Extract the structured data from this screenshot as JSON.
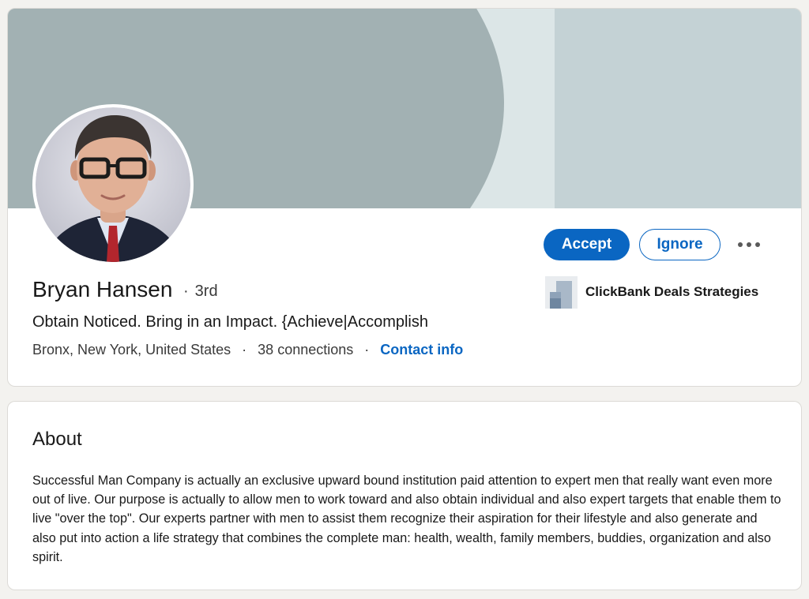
{
  "profile": {
    "name": "Bryan Hansen",
    "degree": "3rd",
    "headline": "Obtain Noticed. Bring in an Impact. {Achieve|Accomplish",
    "location": "Bronx, New York, United States",
    "connections": "38 connections",
    "contact_info": "Contact info",
    "separator": "·"
  },
  "actions": {
    "accept_label": "Accept",
    "ignore_label": "Ignore",
    "more_icon": "more-horizontal-icon"
  },
  "company": {
    "name": "ClickBank Deals Strategies",
    "logo_icon": "company-logo-icon"
  },
  "about": {
    "title": "About",
    "text": "Successful Man Company is actually an exclusive upward bound institution paid attention to expert men that really want even more out of live. Our purpose is actually to allow men to work toward and also obtain individual and also expert targets that enable them to live \"over the top\". Our experts partner with men to assist them recognize their aspiration for their lifestyle and also generate and also put into action a life strategy that combines the complete man: health, wealth, family members, buddies, organization and also spirit."
  },
  "colors": {
    "accent": "#0a66c2",
    "banner_dark": "#a2b1b3",
    "banner_light": "#dce6e7",
    "banner_right": "#c4d2d5",
    "page_background": "#f3f2ef"
  }
}
